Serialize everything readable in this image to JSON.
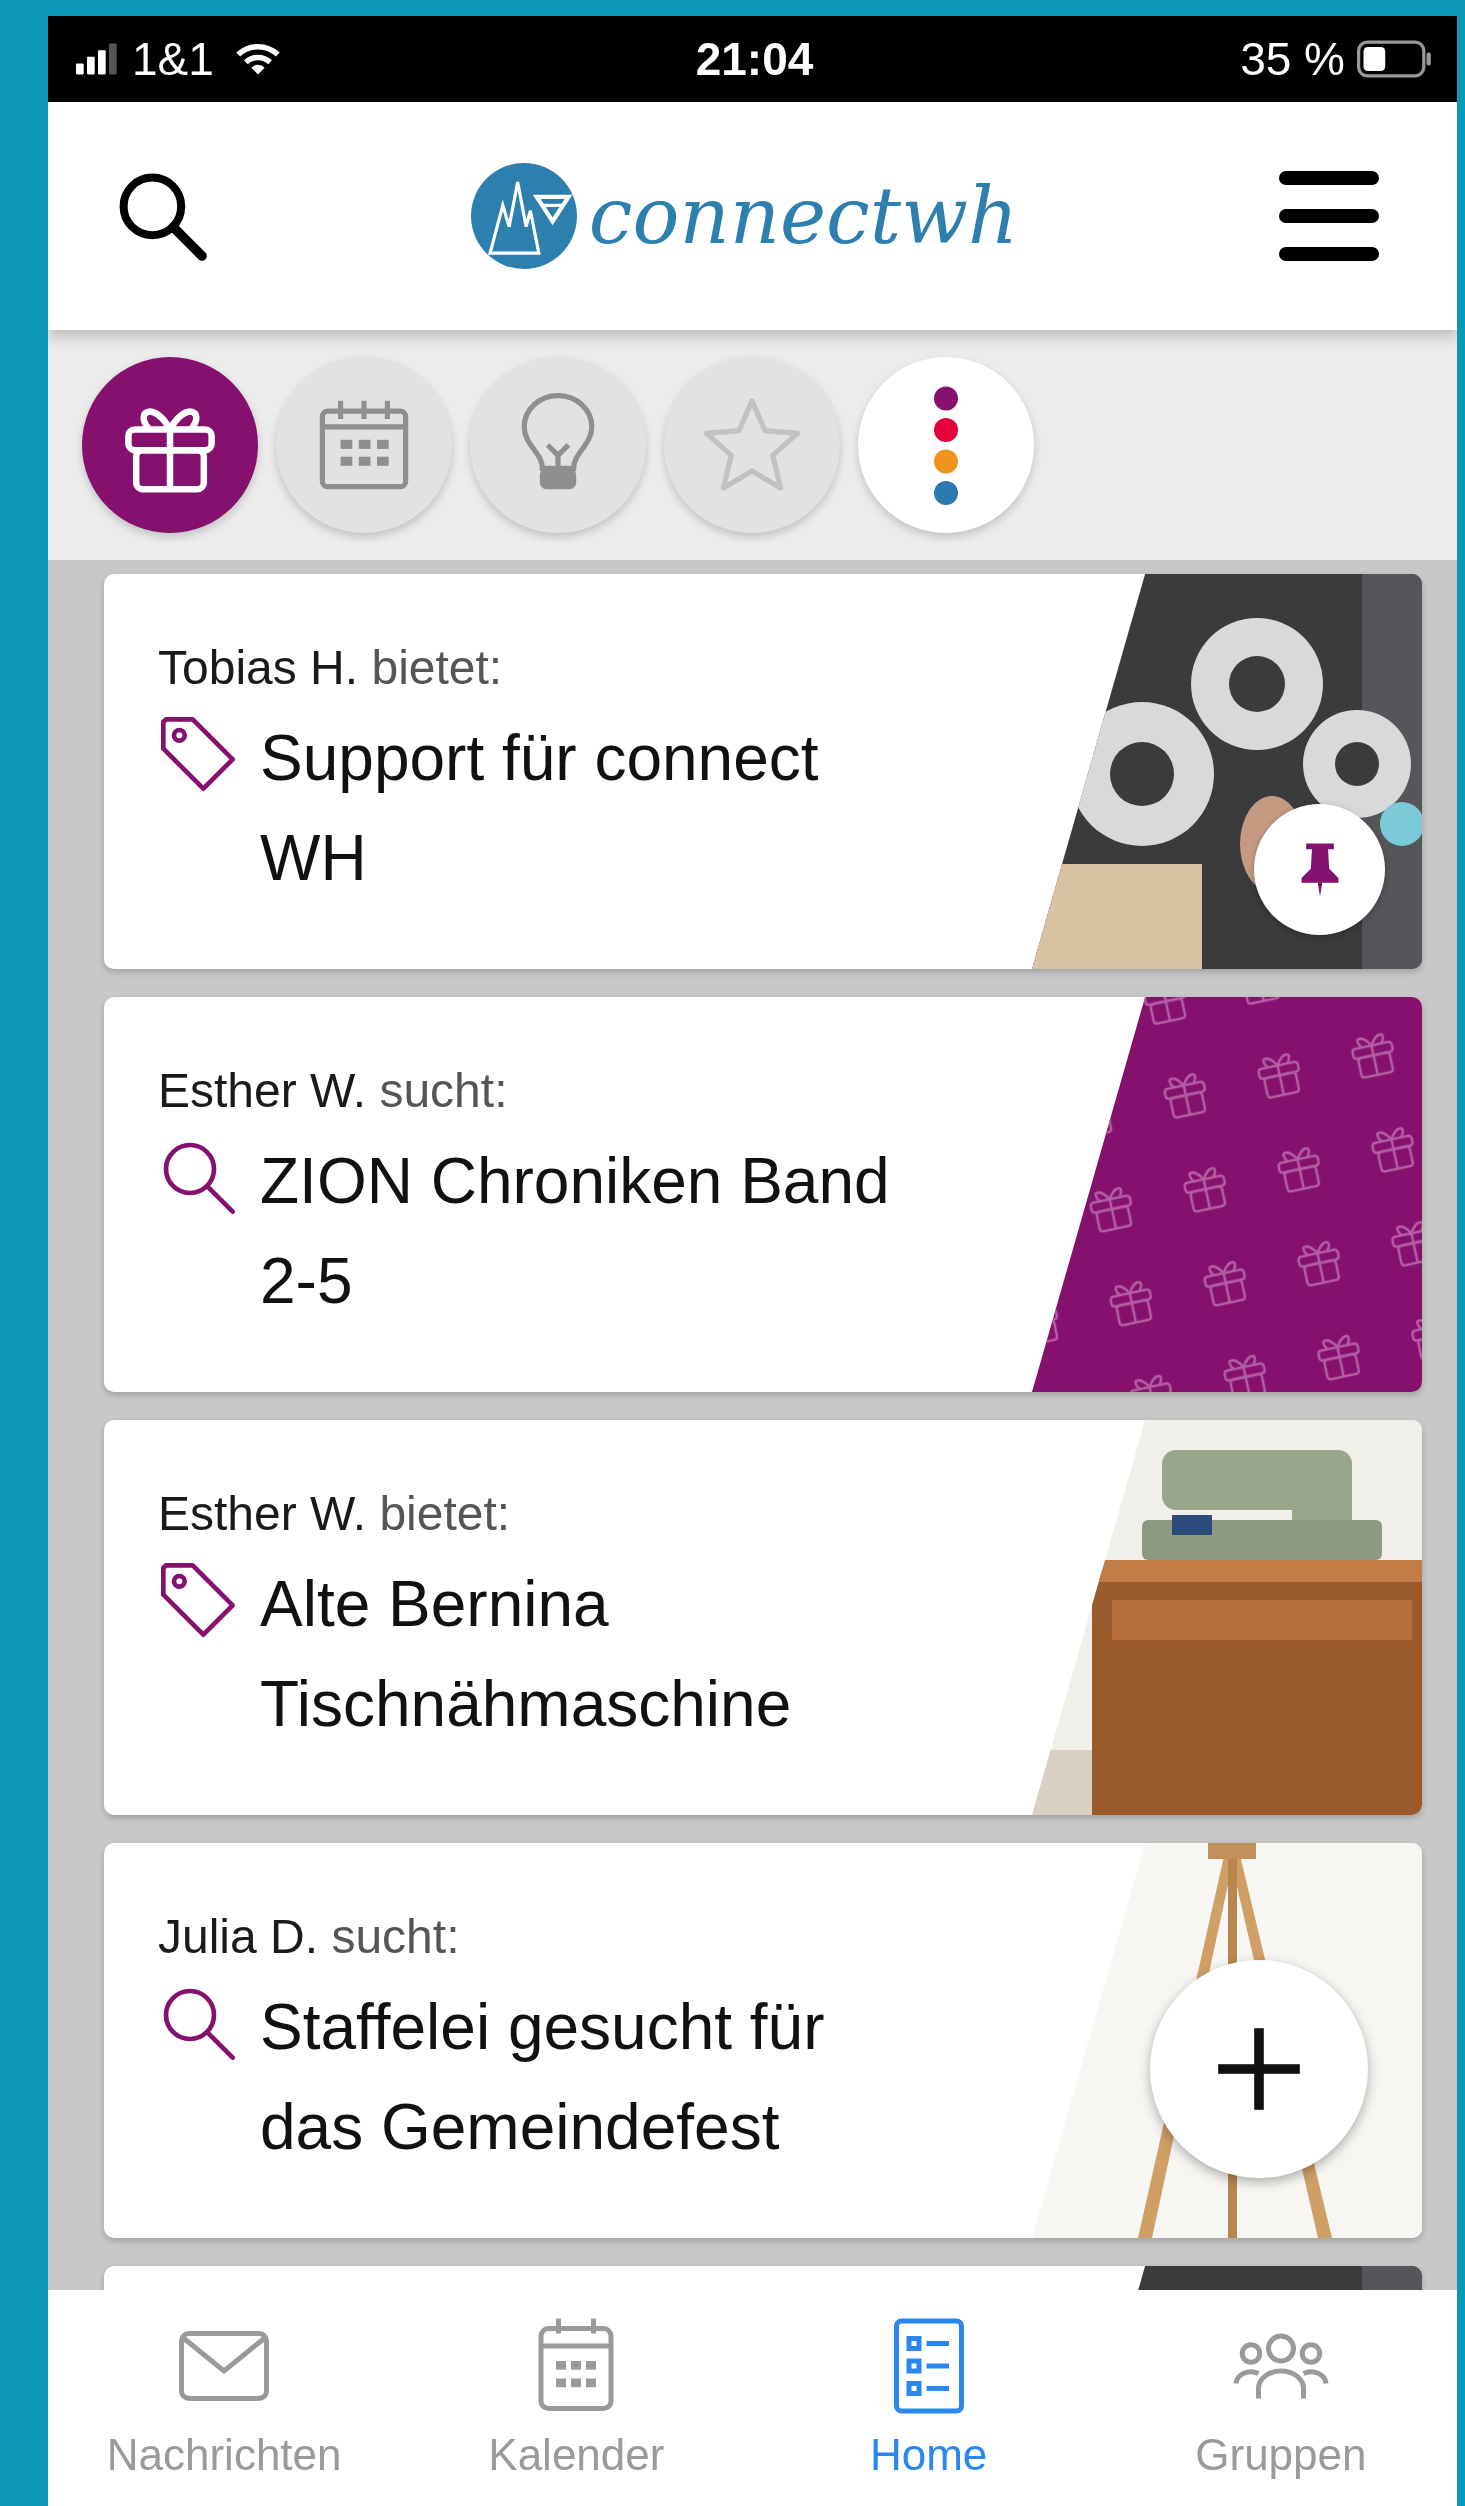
{
  "status_bar": {
    "carrier": "1&1",
    "time": "21:04",
    "battery": "35 %"
  },
  "header": {
    "logo": "connectwh"
  },
  "filters": [
    {
      "kind": "gift",
      "selected": true
    },
    {
      "kind": "calendar",
      "selected": false
    },
    {
      "kind": "bulb",
      "selected": false
    },
    {
      "kind": "star",
      "selected": false
    },
    {
      "kind": "more",
      "selected": false
    }
  ],
  "listings": [
    {
      "name": "Tobias H.",
      "action": "bietet:",
      "kind": "offer",
      "title": "Support für connect WH",
      "pinned": true
    },
    {
      "name": "Esther W.",
      "action": "sucht:",
      "kind": "search",
      "title": "ZION Chroniken Band 2-5",
      "pinned": false,
      "image": {
        "kind": "pattern"
      }
    },
    {
      "name": "Esther W.",
      "action": "bietet:",
      "kind": "offer",
      "title": "Alte Bernina Tischnähmaschine",
      "pinned": false
    },
    {
      "name": "Julia D.",
      "action": "sucht:",
      "kind": "search",
      "title": "Staffelei gesucht für das Gemeindefest",
      "pinned": false
    },
    {
      "kind": "partial"
    }
  ],
  "nav": [
    {
      "kind": "mail",
      "label": "Nachrichten",
      "selected": false
    },
    {
      "kind": "calendar",
      "label": "Kalender",
      "selected": false
    },
    {
      "kind": "list",
      "label": "Home",
      "selected": true
    },
    {
      "kind": "group",
      "label": "Gruppen",
      "selected": false
    }
  ]
}
